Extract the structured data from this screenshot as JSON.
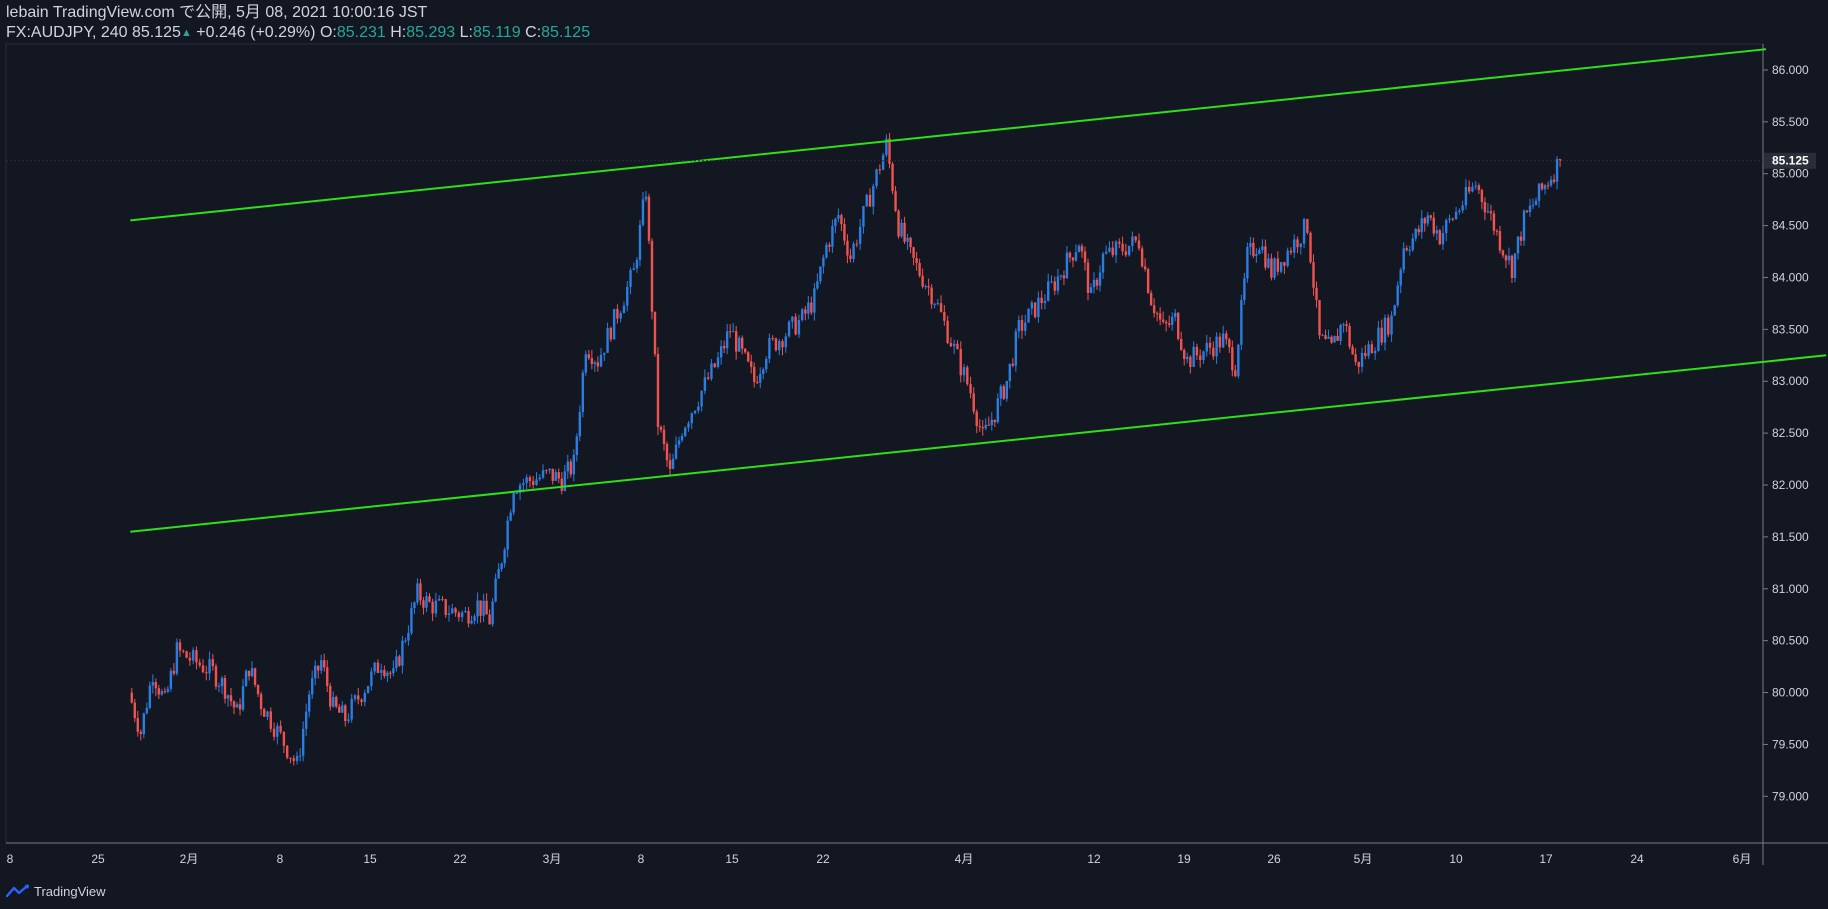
{
  "header": {
    "line1": "lebain TradingView.com で公開, 5月 08, 2021 10:00:16 JST",
    "symbol": "FX:AUDJPY, 240",
    "last": "85.125",
    "arrow": "▲",
    "change": "+0.246 (+0.29%)",
    "o_label": "O:",
    "o_val": "85.231",
    "h_label": "H:",
    "h_val": "85.293",
    "l_label": "L:",
    "l_val": "85.119",
    "c_label": "C:",
    "c_val": "85.125"
  },
  "footer": {
    "brand": "TradingView",
    "logo_icon": "tradingview-logo-icon"
  },
  "colors": {
    "background": "#131722",
    "up": "#2a7de1",
    "down": "#ef5350",
    "channel": "#2ee01a",
    "axis_text": "#d1d4dc",
    "price_label_bg": "#2a2e39"
  },
  "chart_data": {
    "type": "candlestick",
    "symbol": "FX:AUDJPY",
    "interval": "240",
    "current_price": 85.125,
    "ylim": [
      78.55,
      86.25
    ],
    "y_ticks": [
      79.0,
      79.5,
      80.0,
      80.5,
      81.0,
      81.5,
      82.0,
      82.5,
      83.0,
      83.5,
      84.0,
      84.5,
      85.0,
      85.5,
      86.0
    ],
    "y_tick_labels": [
      "79.000",
      "79.500",
      "80.000",
      "80.500",
      "81.000",
      "81.500",
      "82.000",
      "82.500",
      "83.000",
      "83.500",
      "84.000",
      "84.500",
      "85.000",
      "85.500",
      "86.000"
    ],
    "x_tick_labels": [
      "8",
      "25",
      "2月",
      "8",
      "15",
      "22",
      "3月",
      "8",
      "15",
      "22",
      "4月",
      "12",
      "19",
      "26",
      "5月",
      "10",
      "17",
      "24",
      "6月"
    ],
    "close_series": [
      [
        "2021-01-18",
        80.0
      ],
      [
        "2021-01-19",
        79.62
      ],
      [
        "2021-01-20",
        80.2
      ],
      [
        "2021-01-21",
        79.9
      ],
      [
        "2021-01-22",
        80.4
      ],
      [
        "2021-01-25",
        80.2
      ],
      [
        "2021-01-26",
        80.05
      ],
      [
        "2021-01-27",
        79.8
      ],
      [
        "2021-01-28",
        80.25
      ],
      [
        "2021-01-29",
        79.9
      ],
      [
        "2021-02-01",
        79.3
      ],
      [
        "2021-02-02",
        80.0
      ],
      [
        "2021-02-03",
        80.3
      ],
      [
        "2021-02-04",
        79.85
      ],
      [
        "2021-02-05",
        79.75
      ],
      [
        "2021-02-08",
        80.3
      ],
      [
        "2021-02-09",
        80.15
      ],
      [
        "2021-02-10",
        80.55
      ],
      [
        "2021-02-11",
        80.95
      ],
      [
        "2021-02-12",
        80.85
      ],
      [
        "2021-02-15",
        80.75
      ],
      [
        "2021-02-16",
        80.85
      ],
      [
        "2021-02-17",
        80.7
      ],
      [
        "2021-02-18",
        81.3
      ],
      [
        "2021-02-19",
        82.0
      ],
      [
        "2021-02-22",
        82.1
      ],
      [
        "2021-02-23",
        82.05
      ],
      [
        "2021-02-24",
        82.2
      ],
      [
        "2021-02-25",
        83.35
      ],
      [
        "2021-02-26",
        83.2
      ],
      [
        "2021-03-01",
        84.05
      ],
      [
        "2021-03-02",
        84.85
      ],
      [
        "2021-03-03",
        82.6
      ],
      [
        "2021-03-04",
        82.1
      ],
      [
        "2021-03-05",
        82.55
      ],
      [
        "2021-03-08",
        83.2
      ],
      [
        "2021-03-09",
        83.5
      ],
      [
        "2021-03-10",
        83.25
      ],
      [
        "2021-03-11",
        83.0
      ],
      [
        "2021-03-12",
        83.3
      ],
      [
        "2021-03-15",
        83.6
      ],
      [
        "2021-03-16",
        83.8
      ],
      [
        "2021-03-17",
        84.3
      ],
      [
        "2021-03-18",
        84.6
      ],
      [
        "2021-03-19",
        84.2
      ],
      [
        "2021-03-22",
        85.28
      ],
      [
        "2021-03-23",
        84.5
      ],
      [
        "2021-03-24",
        84.2
      ],
      [
        "2021-03-25",
        84.0
      ],
      [
        "2021-03-26",
        83.8
      ],
      [
        "2021-03-29",
        82.9
      ],
      [
        "2021-03-30",
        82.45
      ],
      [
        "2021-03-31",
        82.7
      ],
      [
        "2021-04-01",
        83.0
      ],
      [
        "2021-04-02",
        83.5
      ],
      [
        "2021-04-05",
        83.95
      ],
      [
        "2021-04-06",
        84.15
      ],
      [
        "2021-04-07",
        84.35
      ],
      [
        "2021-04-08",
        83.8
      ],
      [
        "2021-04-09",
        84.2
      ],
      [
        "2021-04-12",
        84.35
      ],
      [
        "2021-04-13",
        83.8
      ],
      [
        "2021-04-14",
        83.5
      ],
      [
        "2021-04-15",
        83.6
      ],
      [
        "2021-04-16",
        83.2
      ],
      [
        "2021-04-19",
        83.4
      ],
      [
        "2021-04-20",
        83.15
      ],
      [
        "2021-04-21",
        84.2
      ],
      [
        "2021-04-22",
        84.35
      ],
      [
        "2021-04-23",
        84.05
      ],
      [
        "2021-04-26",
        84.5
      ],
      [
        "2021-04-27",
        83.4
      ],
      [
        "2021-04-28",
        83.3
      ],
      [
        "2021-04-29",
        83.6
      ],
      [
        "2021-04-30",
        83.15
      ],
      [
        "2021-05-03",
        83.6
      ],
      [
        "2021-05-04",
        84.3
      ],
      [
        "2021-05-05",
        84.4
      ],
      [
        "2021-05-06",
        84.6
      ],
      [
        "2021-05-07",
        84.4
      ],
      [
        "2021-05-10",
        84.9
      ],
      [
        "2021-05-11",
        84.65
      ],
      [
        "2021-05-12",
        84.35
      ],
      [
        "2021-05-13",
        84.1
      ],
      [
        "2021-05-14",
        84.55
      ],
      [
        "2021-05-15",
        84.75
      ],
      [
        "2021-05-17",
        85.125
      ]
    ],
    "trendlines": [
      {
        "from": [
          "2021-01-18",
          84.55
        ],
        "to": [
          "2021-06-03",
          86.2
        ]
      },
      {
        "from": [
          "2021-01-18",
          81.55
        ],
        "to": [
          "2021-06-08",
          83.25
        ]
      }
    ]
  }
}
